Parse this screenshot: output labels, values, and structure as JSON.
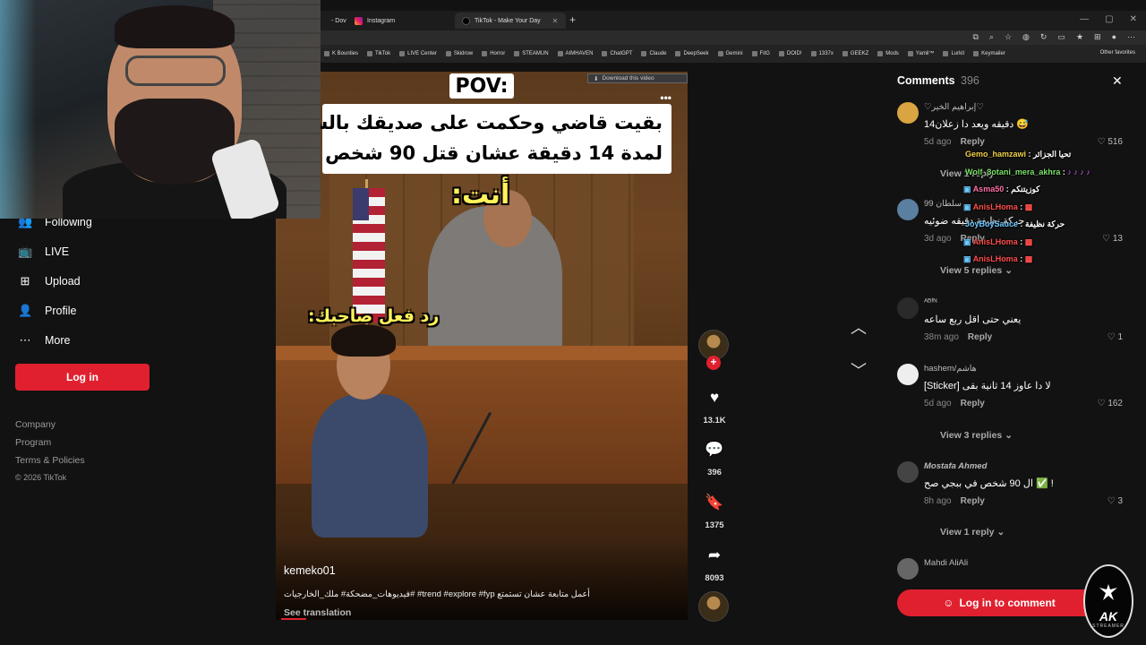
{
  "browser": {
    "tabs": [
      {
        "label": "Instagram",
        "icon": "instagram-icon"
      },
      {
        "label": "TikTok - Make Your Day",
        "icon": "tiktok-icon"
      }
    ],
    "partial_tab": "- Dov",
    "bookmarks": [
      "K Bounties",
      "TikTok",
      "LIVE Center",
      "Skidrow",
      "Horror",
      "STEAMUN",
      "AIMHAVEN",
      "ChatGPT",
      "Claude",
      "DeepSeek",
      "Gemini",
      "FitG",
      "DOID!",
      "1337x",
      "GEEKZ",
      "Mods",
      "Yamil™",
      "Lurkit",
      "Keymailer"
    ],
    "other_favorites": "Other favorites"
  },
  "sidebar": {
    "items": [
      {
        "label": "Following",
        "icon": "following-icon"
      },
      {
        "label": "LIVE",
        "icon": "live-icon"
      },
      {
        "label": "Upload",
        "icon": "upload-icon"
      },
      {
        "label": "Profile",
        "icon": "profile-icon"
      },
      {
        "label": "More",
        "icon": "more-icon"
      }
    ],
    "login_label": "Log in",
    "footer": [
      "Company",
      "Program",
      "Terms & Policies"
    ],
    "copyright": "© 2026 TikTok"
  },
  "video": {
    "download_label": "Download this video",
    "pov": "POV:",
    "caption_lines": [
      "بقيت قاضي وحكمت على صديقك بالسجن",
      "لمدة 14 دقيقة عشان قتل 90 شخص"
    ],
    "overlay_you": "أنت:",
    "overlay_friend": "رد فعل صاحبك:",
    "author": "kemeko01",
    "description": "فيديوهات_مضحكة# ملك_الخارجيات# #trend #explore #fyp أعمل متابعة عشان تستمتع",
    "see_translation": "See translation",
    "progress": 0.06
  },
  "actions": {
    "likes": "13.1K",
    "comments": "396",
    "bookmarks": "1375",
    "shares": "8093"
  },
  "comments_panel": {
    "title": "Comments",
    "count": "396",
    "comments": [
      {
        "user": "♡إبراهيم الخير♡",
        "text": "دقيقه ويعد دا زعلان14 😅",
        "time": "5d ago",
        "reply": "Reply",
        "likes": "516",
        "view": "View 1 reply"
      },
      {
        "user": "سلطان 99",
        "text": "حركة نظيفة دقيقه ضوئيه",
        "time": "3d ago",
        "reply": "Reply",
        "likes": "13",
        "view": "View 5 replies"
      },
      {
        "user": "ᴬᴮᶠᴺ",
        "text": "يعني حتى اقل ربع ساعه",
        "time": "38m ago",
        "reply": "Reply",
        "likes": "1",
        "view": ""
      },
      {
        "user": "hashem/هاشم",
        "text": "[Sticker] لا دا عاوز 14 ثانية بقى",
        "time": "5d ago",
        "reply": "Reply",
        "likes": "162",
        "view": "View 3 replies"
      },
      {
        "user": "Mostafa Ahmed",
        "text": "ال 90 شخص في ببجي صح ✅ !",
        "time": "8h ago",
        "reply": "Reply",
        "likes": "3",
        "view": "View 1 reply"
      },
      {
        "user": "Mahdi AliAli",
        "text": "",
        "time": "",
        "reply": "",
        "likes": "",
        "view": ""
      }
    ],
    "login_label": "Log in to comment"
  },
  "stream_chat": [
    {
      "name": "Gemo_hamzawi",
      "msg": "تحيا الجزائر",
      "color": "#f2d04a"
    },
    {
      "name": "Wolf_3otani_mera_akhra",
      "msg": "",
      "color": "#7be06a"
    },
    {
      "name": "Asma50",
      "msg": "كوزيتنكم",
      "color": "#ff6fa8"
    },
    {
      "name": "AnisLHoma",
      "msg": "",
      "color": "#ff4d4d"
    },
    {
      "name": "JoyBoySauce",
      "msg": "حركة نظيفة",
      "color": "#6cc8ff"
    },
    {
      "name": "AnisLHoma",
      "msg": "",
      "color": "#ff4d4d"
    },
    {
      "name": "AnisLHoma",
      "msg": "",
      "color": "#ff4d4d"
    }
  ],
  "logo": {
    "text": "AK",
    "sub": "STREAMER"
  },
  "colors": {
    "accent": "#e0202f",
    "background": "#121212"
  }
}
